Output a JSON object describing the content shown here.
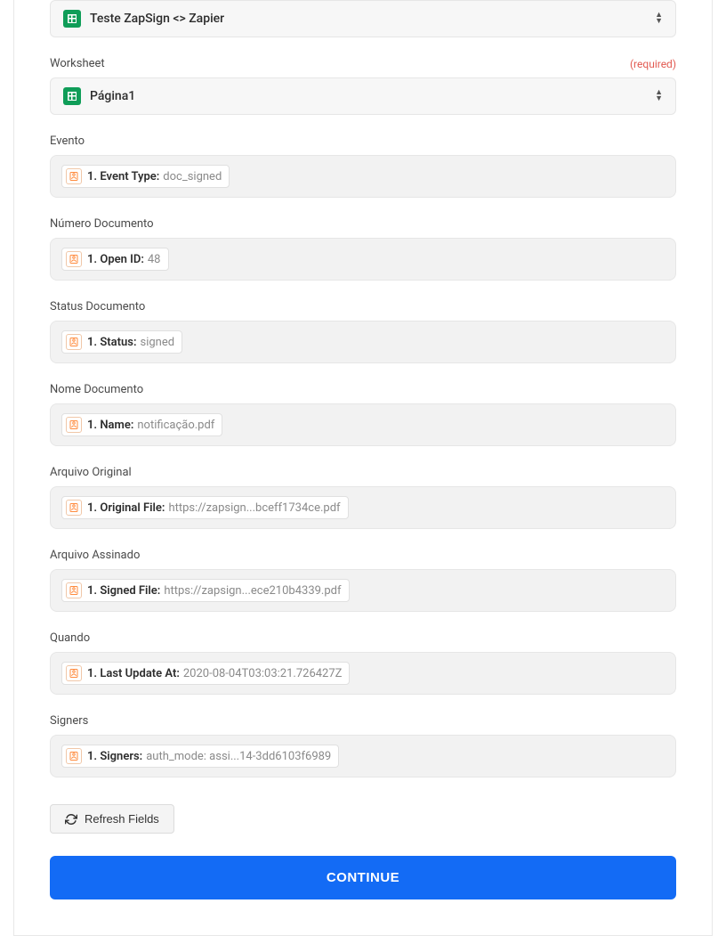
{
  "spreadsheet": {
    "value": "Teste ZapSign <> Zapier"
  },
  "worksheet": {
    "label": "Worksheet",
    "required_text": "(required)",
    "value": "Página1"
  },
  "fields": [
    {
      "label": "Evento",
      "chip_label": "1. Event Type:",
      "chip_value": "doc_signed"
    },
    {
      "label": "Número Documento",
      "chip_label": "1. Open ID:",
      "chip_value": "48"
    },
    {
      "label": "Status Documento",
      "chip_label": "1. Status:",
      "chip_value": "signed"
    },
    {
      "label": "Nome Documento",
      "chip_label": "1. Name:",
      "chip_value": "notificação.pdf"
    },
    {
      "label": "Arquivo Original",
      "chip_label": "1. Original File:",
      "chip_value": "https://zapsign...bceff1734ce.pdf"
    },
    {
      "label": "Arquivo Assinado",
      "chip_label": "1. Signed File:",
      "chip_value": "https://zapsign...ece210b4339.pdf"
    },
    {
      "label": "Quando",
      "chip_label": "1. Last Update At:",
      "chip_value": "2020-08-04T03:03:21.726427Z"
    },
    {
      "label": "Signers",
      "chip_label": "1. Signers:",
      "chip_value": "auth_mode: assi...14-3dd6103f6989"
    }
  ],
  "buttons": {
    "refresh": "Refresh Fields",
    "continue": "CONTINUE"
  }
}
